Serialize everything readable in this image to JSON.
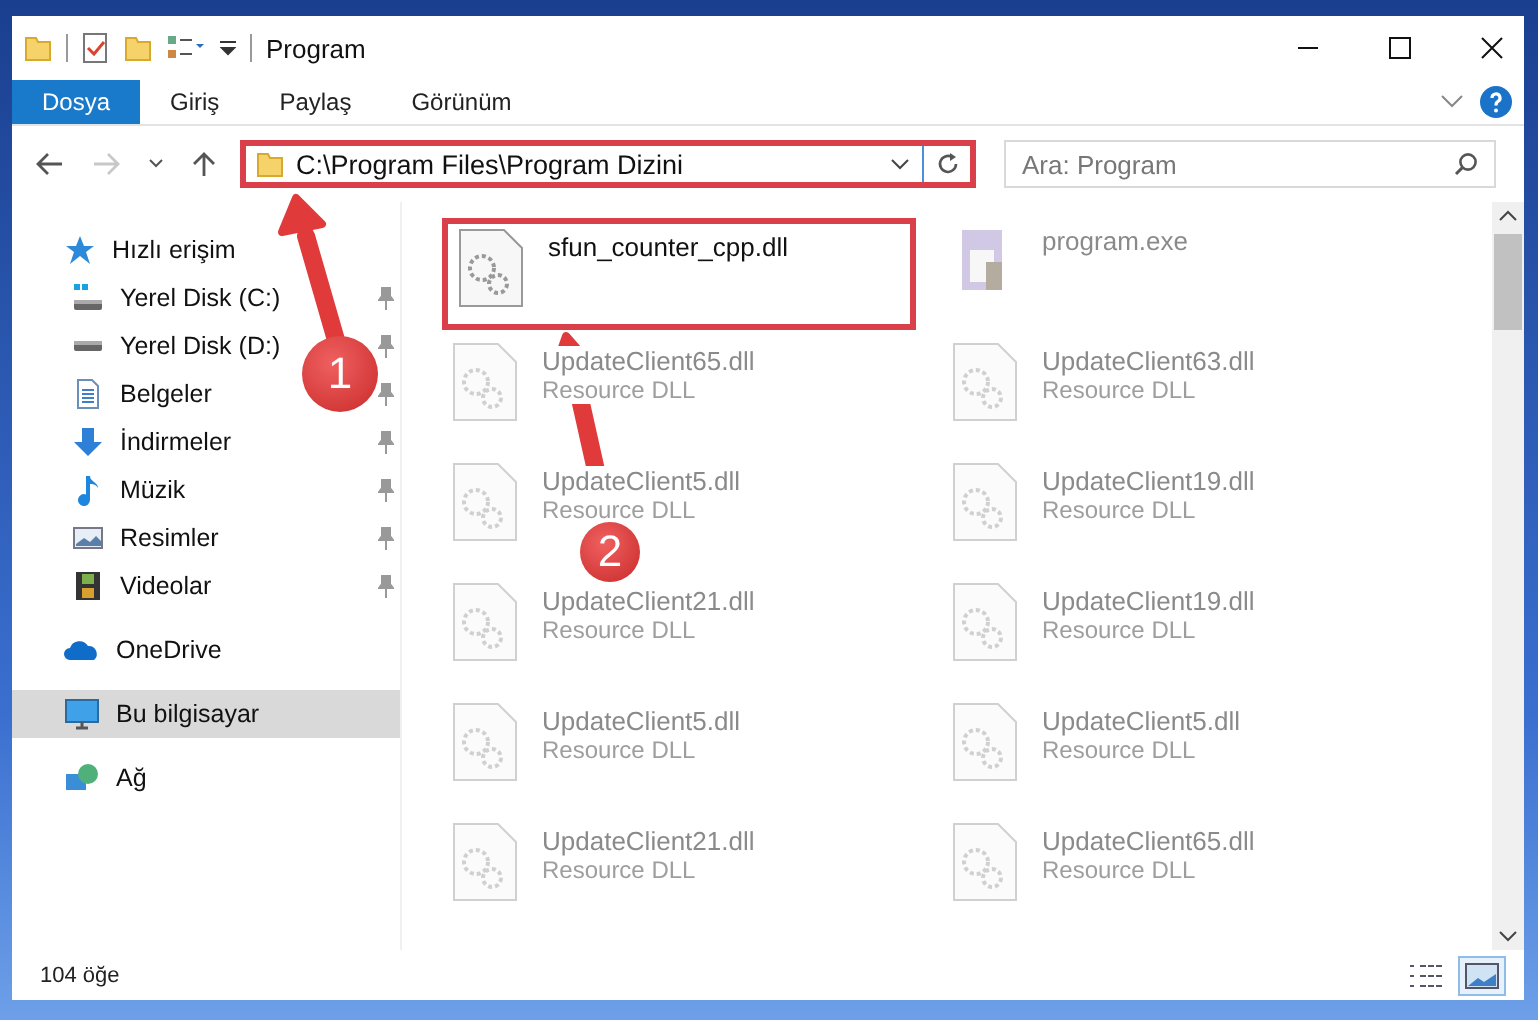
{
  "window": {
    "title": "Program"
  },
  "ribbon_tabs": [
    {
      "label": "Dosya",
      "selected": true
    },
    {
      "label": "Giriş",
      "selected": false
    },
    {
      "label": "Paylaş",
      "selected": false
    },
    {
      "label": "Görünüm",
      "selected": false
    }
  ],
  "navigation": {
    "forward_disabled": true,
    "address": "C:\\Program Files\\Program Dizini",
    "address_highlighted": true,
    "search": {
      "placeholder": "Ara: Program"
    }
  },
  "sidebar": {
    "items": [
      {
        "label": "Hızlı erişim",
        "kind": "star",
        "selected": false,
        "children": [
          {
            "label": "Yerel Disk (C:)",
            "kind": "system-drive",
            "pinned": true,
            "selected": false
          },
          {
            "label": "Yerel Disk (D:)",
            "kind": "drive",
            "pinned": true,
            "selected": false
          },
          {
            "label": "Belgeler",
            "kind": "documents",
            "pinned": true,
            "selected": false
          },
          {
            "label": "İndirmeler",
            "kind": "downloads",
            "pinned": true,
            "selected": false
          },
          {
            "label": "Müzik",
            "kind": "music",
            "pinned": true,
            "selected": false
          },
          {
            "label": "Resimler",
            "kind": "pictures",
            "pinned": true,
            "selected": false
          },
          {
            "label": "Videolar",
            "kind": "videos",
            "pinned": true,
            "selected": false
          }
        ]
      },
      {
        "label": "OneDrive",
        "kind": "cloud",
        "selected": false
      },
      {
        "label": "Bu bilgisayar",
        "kind": "computer",
        "selected": true
      },
      {
        "label": "Ağ",
        "kind": "network",
        "selected": false
      }
    ]
  },
  "files": [
    {
      "name": "sfun_counter_cpp.dll",
      "kind": "dll",
      "blurred": false,
      "highlighted": true
    },
    {
      "name": "program.exe",
      "kind": "exe",
      "blurred": true,
      "highlighted": false
    },
    {
      "name": "UpdateClient65.dll",
      "type": "Resource DLL",
      "kind": "dll",
      "blurred": true,
      "highlighted": false
    },
    {
      "name": "UpdateClient63.dll",
      "type": "Resource DLL",
      "kind": "dll",
      "blurred": true,
      "highlighted": false
    },
    {
      "name": "UpdateClient5.dll",
      "type": "Resource DLL",
      "kind": "dll",
      "blurred": true,
      "highlighted": false
    },
    {
      "name": "UpdateClient19.dll",
      "type": "Resource DLL",
      "kind": "dll",
      "blurred": true,
      "highlighted": false
    },
    {
      "name": "UpdateClient21.dll",
      "type": "Resource DLL",
      "kind": "dll",
      "blurred": true,
      "highlighted": false
    },
    {
      "name": "UpdateClient19.dll",
      "type": "Resource DLL",
      "kind": "dll",
      "blurred": true,
      "highlighted": false
    },
    {
      "name": "UpdateClient5.dll",
      "type": "Resource DLL",
      "kind": "dll",
      "blurred": true,
      "highlighted": false
    },
    {
      "name": "UpdateClient5.dll",
      "type": "Resource DLL",
      "kind": "dll",
      "blurred": true,
      "highlighted": false
    },
    {
      "name": "UpdateClient21.dll",
      "type": "Resource DLL",
      "kind": "dll",
      "blurred": true,
      "highlighted": false
    },
    {
      "name": "UpdateClient65.dll",
      "type": "Resource DLL",
      "kind": "dll",
      "blurred": true,
      "highlighted": false
    }
  ],
  "status_bar": {
    "item_count": "104 öğe",
    "large_icons_view": true
  },
  "annotations": [
    {
      "label": "1"
    },
    {
      "label": "2"
    }
  ]
}
